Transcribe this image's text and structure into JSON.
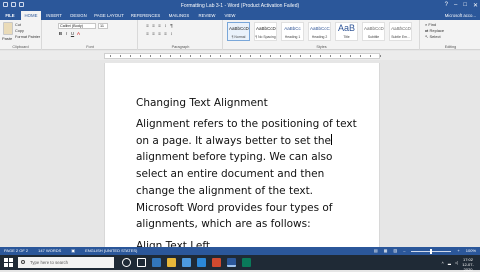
{
  "window": {
    "title": "Formatting Lab 3-1 - Word (Product Activation Failed)"
  },
  "tabs": {
    "file": "FILE",
    "home": "HOME",
    "insert": "INSERT",
    "design": "DESIGN",
    "page_layout": "PAGE LAYOUT",
    "references": "REFERENCES",
    "mailings": "MAILINGS",
    "review": "REVIEW",
    "view": "VIEW",
    "account": "Microsoft acco..."
  },
  "ribbon": {
    "clipboard": {
      "paste": "Paste",
      "cut": "Cut",
      "copy": "Copy",
      "format_painter": "Format Painter",
      "group_label": "Clipboard"
    },
    "font": {
      "font_name": "Calibri (Body)",
      "font_size": "11",
      "bold": "B",
      "italic": "I",
      "underline": "U",
      "group_label": "Font"
    },
    "paragraph": {
      "group_label": "Paragraph"
    },
    "styles": {
      "group_label": "Styles",
      "items": [
        {
          "preview": "AaBbCcDc",
          "name": "¶ Normal"
        },
        {
          "preview": "AaBbCcDc",
          "name": "¶ No Spacing"
        },
        {
          "preview": "AaBbCc",
          "name": "Heading 1"
        },
        {
          "preview": "AaBbCcC",
          "name": "Heading 2"
        },
        {
          "preview": "AaB",
          "name": "Title"
        },
        {
          "preview": "AaBbCcD",
          "name": "Subtitle"
        },
        {
          "preview": "AaBbCcDa",
          "name": "Subtle Em..."
        }
      ]
    },
    "editing": {
      "find": "Find",
      "replace": "Replace",
      "select": "Select",
      "group_label": "Editing"
    }
  },
  "document": {
    "heading": "Changing Text Alignment",
    "lines": [
      "Alignment refers to the positioning of text",
      "on a page. It always better to set the",
      "alignment before typing. We can also",
      "select an entire document and then",
      "change the alignment of the text.",
      "Microsoft Word provides four types of",
      "alignments, which are as follows:"
    ],
    "subheading": "Align Text Left"
  },
  "status": {
    "page": "PAGE 2 OF 2",
    "words": "147 WORDS",
    "language": "ENGLISH (UNITED STATES)",
    "zoom": "100%"
  },
  "taskbar": {
    "search_placeholder": "Type here to search",
    "time": "17:02",
    "date": "12-07-2020"
  }
}
